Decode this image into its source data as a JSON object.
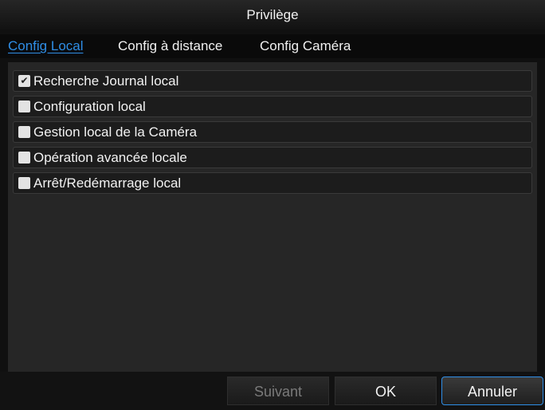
{
  "dialog": {
    "title": "Privilège"
  },
  "tabs": [
    {
      "label": "Config Local",
      "active": true
    },
    {
      "label": "Config à distance",
      "active": false
    },
    {
      "label": "Config Caméra",
      "active": false
    }
  ],
  "permissions": [
    {
      "label": "Recherche Journal local",
      "checked": true,
      "mark": "✔"
    },
    {
      "label": "Configuration local",
      "checked": false,
      "mark": ""
    },
    {
      "label": "Gestion local de la Caméra",
      "checked": false,
      "mark": ""
    },
    {
      "label": "Opération avancée locale",
      "checked": false,
      "mark": ""
    },
    {
      "label": "Arrêt/Redémarrage local",
      "checked": false,
      "mark": ""
    }
  ],
  "buttons": {
    "next": "Suivant",
    "ok": "OK",
    "cancel": "Annuler"
  },
  "colors": {
    "accent": "#2f8ee6"
  }
}
